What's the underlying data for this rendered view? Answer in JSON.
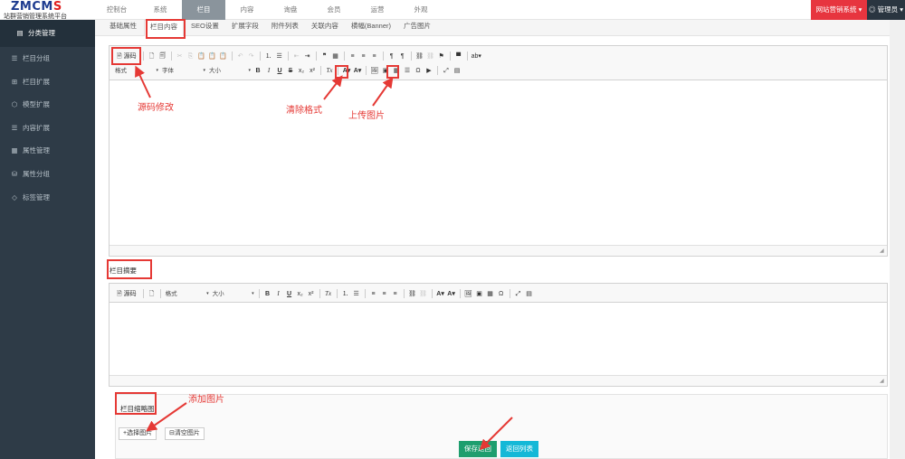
{
  "logo": {
    "main_a": "ZMCM",
    "main_b": "S",
    "sub": "站群营销管理系统平台"
  },
  "topnav": [
    "控制台",
    "系统",
    "栏目",
    "内容",
    "询盘",
    "会员",
    "运营",
    "外观"
  ],
  "topnav_active": "栏目",
  "site_button": "网站营销系统 ▾",
  "admin_button": "◎ 管理员 ▾",
  "sidebar": [
    {
      "icon": "▤",
      "label": "分类管理"
    },
    {
      "icon": "☰",
      "label": "栏目分组"
    },
    {
      "icon": "⊞",
      "label": "栏目扩展"
    },
    {
      "icon": "⬡",
      "label": "模型扩展"
    },
    {
      "icon": "☰",
      "label": "内容扩展"
    },
    {
      "icon": "▦",
      "label": "属性管理"
    },
    {
      "icon": "⛁",
      "label": "属性分组"
    },
    {
      "icon": "◇",
      "label": "标签管理"
    }
  ],
  "tabs": [
    "基础属性",
    "栏目内容",
    "SEO设置",
    "扩展字段",
    "附件列表",
    "关联内容",
    "横幅(Banner)",
    "广告图片"
  ],
  "tab_active": "栏目内容",
  "editor1": {
    "source_label": "源码",
    "format_label": "格式",
    "font_label": "字体",
    "size_label": "大小"
  },
  "summary_label": "栏目摘要",
  "editor2": {
    "source_label": "源码",
    "format_label": "格式",
    "size_label": "大小"
  },
  "thumb": {
    "label": "栏目缩略图",
    "choose_button": "+选择图片",
    "clear_button": "⊟清空图片"
  },
  "save_button": "保存返回",
  "return_button": "返回列表",
  "annotations": {
    "source": "源码修改",
    "clear_format": "清除格式",
    "upload_image": "上传图片",
    "add_image": "添加图片"
  },
  "colors": {
    "accent_red": "#e53935",
    "save_green": "#1e9e6e",
    "return_cyan": "#14b8d7",
    "sidebar_bg": "#2e3b47"
  }
}
